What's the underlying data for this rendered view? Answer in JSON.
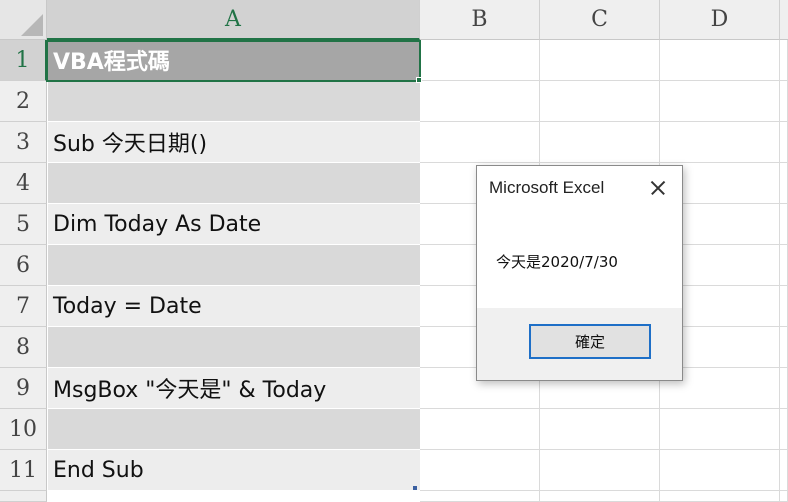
{
  "columns": [
    "A",
    "B",
    "C",
    "D"
  ],
  "rows": [
    "1",
    "2",
    "3",
    "4",
    "5",
    "6",
    "7",
    "8",
    "9",
    "10",
    "11"
  ],
  "cells_a": [
    "VBA程式碼",
    "",
    "Sub 今天日期()",
    "",
    "Dim Today As Date",
    "",
    "Today = Date",
    "",
    "MsgBox \"今天是\" & Today",
    "",
    "End Sub"
  ],
  "selected_cell": "A1",
  "dialog": {
    "title": "Microsoft Excel",
    "message": "今天是2020/7/30",
    "ok_label": "確定"
  },
  "colors": {
    "accent": "#217346",
    "title_fill": "#a6a6a6",
    "band_light": "#ededed",
    "band_dark": "#d9d9d9",
    "button_border": "#1e6fc7"
  }
}
